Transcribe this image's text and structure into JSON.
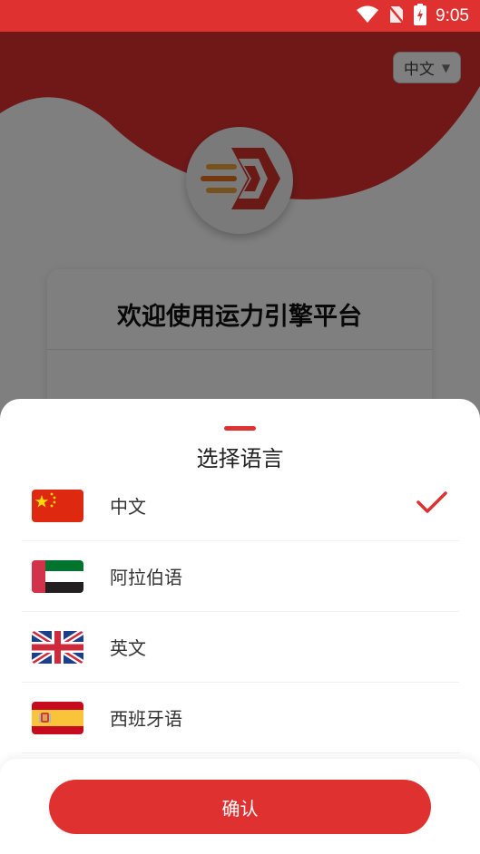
{
  "status_bar": {
    "time": "9:05",
    "icons": [
      "wifi-icon",
      "no-sim-icon",
      "battery-charging-icon"
    ]
  },
  "background_page": {
    "language_selector": {
      "value": "中文"
    },
    "logo": {
      "icon": "engine-logo-icon"
    },
    "welcome_title": "欢迎使用运力引擎平台"
  },
  "language_sheet": {
    "title": "选择语言",
    "items": [
      {
        "label": "中文",
        "flag": "china-flag-icon",
        "selected": true
      },
      {
        "label": "阿拉伯语",
        "flag": "uae-flag-icon",
        "selected": false
      },
      {
        "label": "英文",
        "flag": "uk-flag-icon",
        "selected": false
      },
      {
        "label": "西班牙语",
        "flag": "spain-flag-icon",
        "selected": false
      }
    ],
    "confirm_label": "确认"
  },
  "colors": {
    "accent": "#e03131",
    "overlay": "rgba(0,0,0,0.5)"
  }
}
